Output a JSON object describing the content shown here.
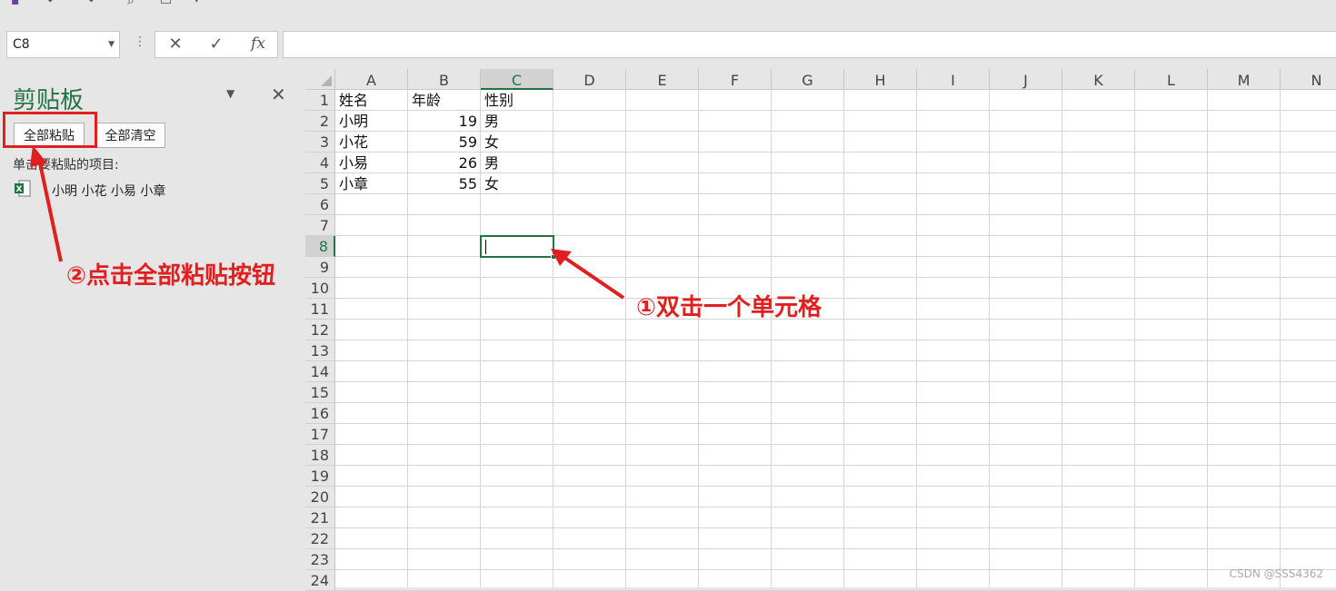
{
  "toolbar": {
    "icons": [
      "save-icon",
      "undo-icon",
      "redo-icon",
      "print-preview-icon",
      "layout-icon",
      "dropdown-icon"
    ]
  },
  "formula_bar": {
    "name_box": "C8",
    "cancel_symbol": "✕",
    "enter_symbol": "✓",
    "fx_label": "fx",
    "formula_value": ""
  },
  "clipboard_pane": {
    "title": "剪贴板",
    "paste_all_label": "全部粘贴",
    "clear_all_label": "全部清空",
    "hint": "单击要粘贴的项目:",
    "item_text": "小明 小花 小易 小章"
  },
  "sheet": {
    "columns": [
      "A",
      "B",
      "C",
      "D",
      "E",
      "F",
      "G",
      "H",
      "I",
      "J",
      "K",
      "L",
      "M",
      "N"
    ],
    "rows": [
      "1",
      "2",
      "3",
      "4",
      "5",
      "6",
      "7",
      "8",
      "9",
      "10",
      "11",
      "12",
      "13",
      "14",
      "15",
      "16",
      "17",
      "18",
      "19",
      "20",
      "21",
      "22",
      "23",
      "24"
    ],
    "active_cell": "C8",
    "cells": {
      "A1": "姓名",
      "B1": "年龄",
      "C1": "性别",
      "A2": "小明",
      "B2": "19",
      "C2": "男",
      "A3": "小花",
      "B3": "59",
      "C3": "女",
      "A4": "小易",
      "B4": "26",
      "C4": "男",
      "A5": "小章",
      "B5": "55",
      "C5": "女"
    }
  },
  "annotations": {
    "step1": "①双击一个单元格",
    "step2": "②点击全部粘贴按钮",
    "color": "#e02020"
  },
  "watermark": "CSDN @SSS4362",
  "colors": {
    "accent": "#217346",
    "annotation": "#e02020"
  }
}
